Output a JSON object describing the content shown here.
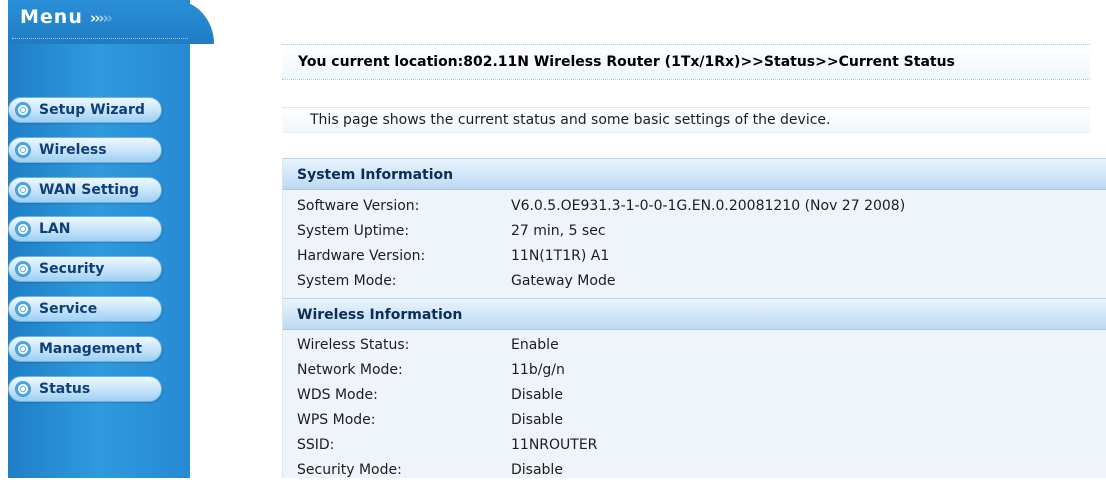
{
  "sidebar": {
    "menu_title": "Menu",
    "items": [
      {
        "label": "Setup Wizard"
      },
      {
        "label": "Wireless"
      },
      {
        "label": "WAN Setting"
      },
      {
        "label": "LAN"
      },
      {
        "label": "Security"
      },
      {
        "label": "Service"
      },
      {
        "label": "Management"
      },
      {
        "label": "Status"
      }
    ]
  },
  "main": {
    "location": "You current location:802.11N Wireless Router (1Tx/1Rx)>>Status>>Current Status",
    "description": "This page shows the current status and some basic settings of the device.",
    "sections": [
      {
        "title": "System Information",
        "rows": [
          {
            "label": "Software Version:",
            "value": "V6.0.5.OE931.3-1-0-0-1G.EN.0.20081210 (Nov 27 2008)"
          },
          {
            "label": "System Uptime:",
            "value": "27 min, 5 sec"
          },
          {
            "label": "Hardware Version:",
            "value": "11N(1T1R) A1"
          },
          {
            "label": "System Mode:",
            "value": "Gateway Mode"
          }
        ]
      },
      {
        "title": "Wireless Information",
        "rows": [
          {
            "label": "Wireless Status:",
            "value": "Enable"
          },
          {
            "label": "Network Mode:",
            "value": "11b/g/n"
          },
          {
            "label": "WDS Mode:",
            "value": "Disable"
          },
          {
            "label": "WPS Mode:",
            "value": "Disable"
          },
          {
            "label": "SSID:",
            "value": "11NROUTER"
          },
          {
            "label": "Security Mode:",
            "value": "Disable"
          }
        ]
      }
    ]
  },
  "colors": {
    "sidebar_blue": "#2689d2",
    "nav_text": "#0e3f78",
    "section_header": "#cfe4f7",
    "panel_background": "#eef4fa"
  }
}
